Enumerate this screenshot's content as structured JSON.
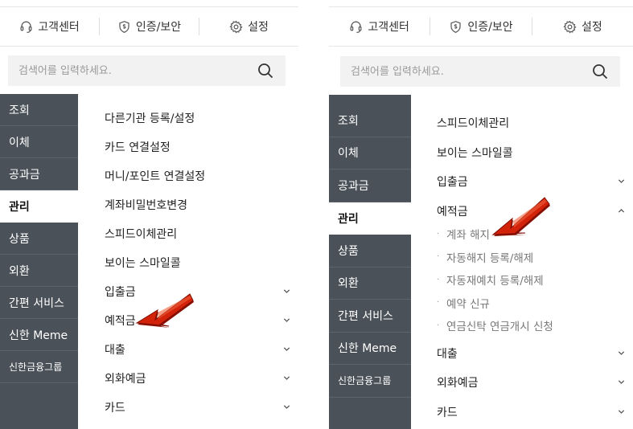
{
  "topbar": {
    "customer_center": "고객센터",
    "auth_security": "인증/보안",
    "settings": "설정"
  },
  "search": {
    "placeholder": "검색어를 입력하세요."
  },
  "sidebar": {
    "items": [
      "조회",
      "이체",
      "공과금",
      "관리",
      "상품",
      "외환",
      "간편 서비스",
      "신한 Meme",
      "신한금융그룹"
    ],
    "active": "관리"
  },
  "left_menu": {
    "items": [
      "다른기관 등록/설정",
      "카드 연결설정",
      "머니/포인트 연결설정",
      "계좌비밀번호변경",
      "스피드이체관리",
      "보이는 스마일콜",
      "입출금",
      "예적금",
      "대출",
      "외화예금",
      "카드"
    ]
  },
  "right_menu": {
    "items_before": [
      "스피드이체관리",
      "보이는 스마일콜",
      "입출금"
    ],
    "expanded": "예적금",
    "sub_items": [
      "계좌 해지",
      "자동해지 등록/해제",
      "자동재예치 등록/해제",
      "예약 신규",
      "연금신탁 연금개시 신청"
    ],
    "items_after": [
      "대출",
      "외화예금",
      "카드"
    ]
  },
  "icons": {
    "headset": "headset-icon",
    "shield": "shield-icon",
    "gear": "gear-icon",
    "search": "search-icon",
    "arrow": "red-arrow-icon"
  },
  "colors": {
    "sidebar": "#4a5158",
    "arrow": "#cc1a00",
    "search_bg": "#f2f2f2"
  }
}
